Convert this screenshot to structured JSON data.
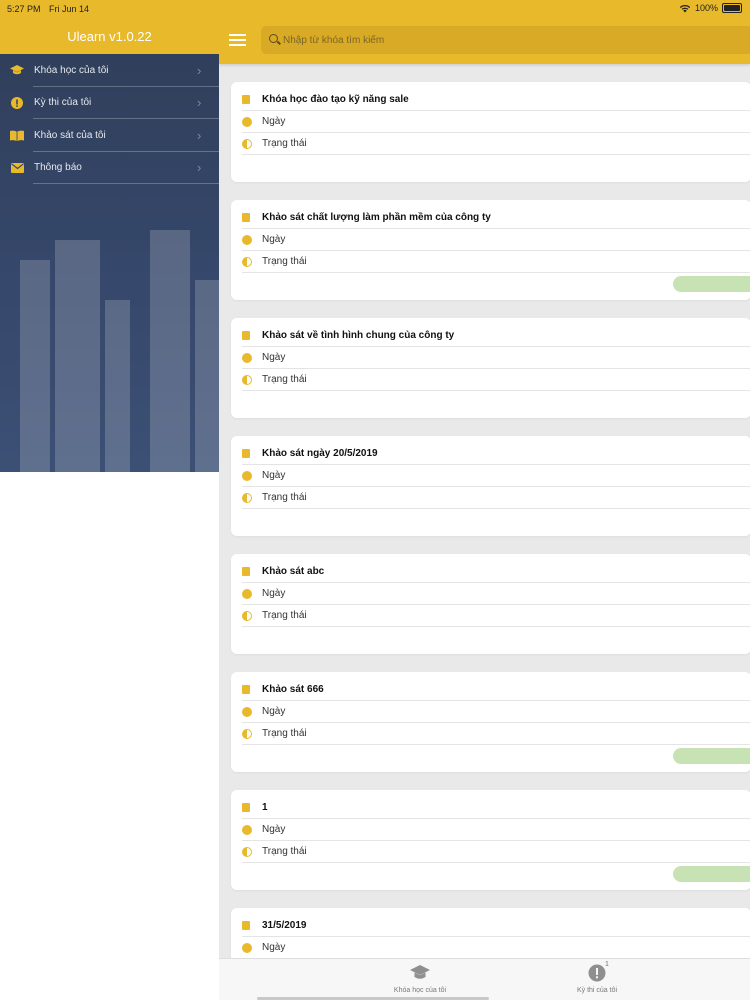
{
  "status_bar": {
    "time": "5:27 PM",
    "date": "Fri Jun 14",
    "battery": "100%"
  },
  "sidebar": {
    "app_title": "Ulearn v1.0.22",
    "items": [
      {
        "label": "Khóa học của tôi",
        "icon": "graduation-cap-icon"
      },
      {
        "label": "Kỳ thi của tôi",
        "icon": "exam-icon"
      },
      {
        "label": "Khảo sát của tôi",
        "icon": "book-icon"
      },
      {
        "label": "Thông báo",
        "icon": "envelope-icon"
      }
    ]
  },
  "search": {
    "placeholder": "Nhập từ khóa tìm kiếm"
  },
  "cards": [
    {
      "title": "Khóa học đào tạo kỹ năng sale",
      "date_label": "Ngày",
      "status_label": "Trạng thái",
      "has_badge": false
    },
    {
      "title": "Khảo sát chất lượng làm phần mềm của công ty",
      "date_label": "Ngày",
      "status_label": "Trạng thái",
      "has_badge": true
    },
    {
      "title": "Khảo sát về tình hình chung của công ty",
      "date_label": "Ngày",
      "status_label": "Trạng thái",
      "has_badge": false
    },
    {
      "title": "Khảo sát ngày 20/5/2019",
      "date_label": "Ngày",
      "status_label": "Trạng thái",
      "has_badge": false
    },
    {
      "title": "Khảo sát abc",
      "date_label": "Ngày",
      "status_label": "Trạng thái",
      "has_badge": false
    },
    {
      "title": "Khảo sát 666",
      "date_label": "Ngày",
      "status_label": "Trạng thái",
      "has_badge": true
    },
    {
      "title": "1",
      "date_label": "Ngày",
      "status_label": "Trạng thái",
      "has_badge": true
    },
    {
      "title": "31/5/2019",
      "date_label": "Ngày",
      "status_label": "",
      "has_badge": false
    }
  ],
  "tabbar": {
    "tab1_label": "Khóa học của tôi",
    "tab2_label": "Kỳ thi của tôi",
    "tab2_badge": "1"
  },
  "colors": {
    "accent": "#e8b92a",
    "sidebar_bg": "#35476a",
    "badge_green": "#c8e3b3"
  }
}
